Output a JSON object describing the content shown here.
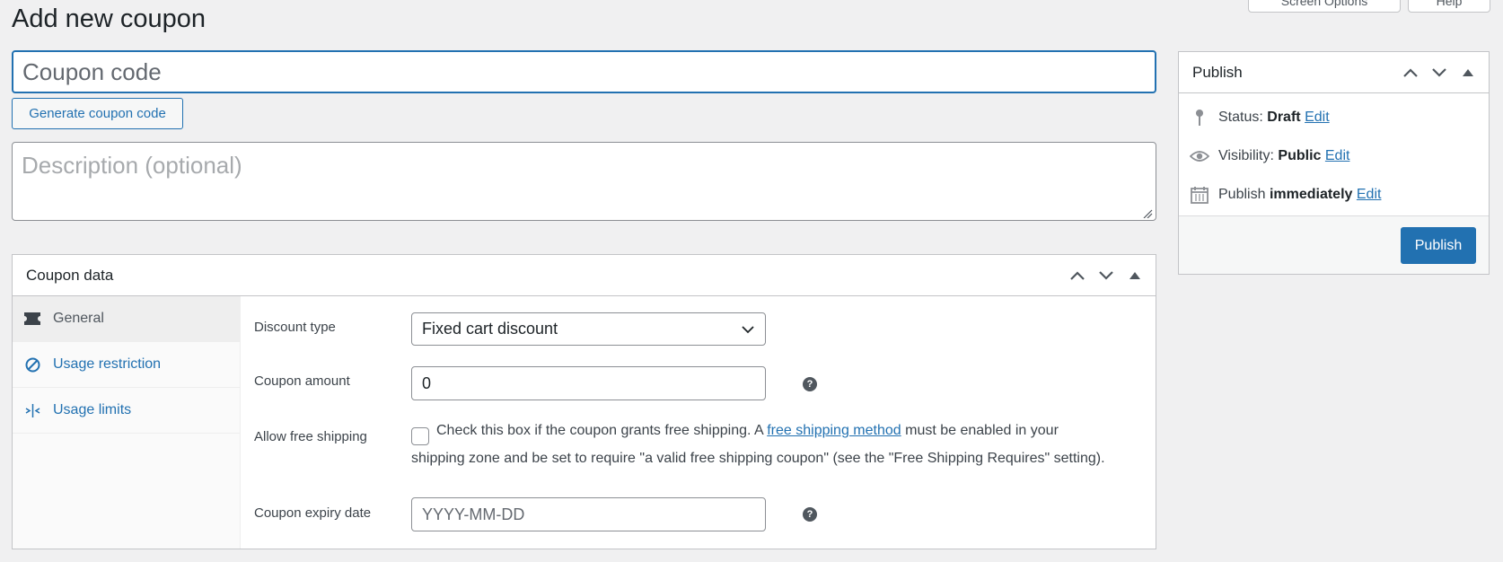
{
  "header": {
    "screen_options_label": "Screen Options",
    "help_label": "Help",
    "title": "Add new coupon"
  },
  "coupon_code": {
    "placeholder": "Coupon code",
    "value": ""
  },
  "generate_label": "Generate coupon code",
  "description": {
    "placeholder": "Description (optional)"
  },
  "coupon_data": {
    "title": "Coupon data",
    "tabs": [
      {
        "label": "General",
        "icon": "ticket-icon",
        "active": true
      },
      {
        "label": "Usage restriction",
        "icon": "restriction-icon"
      },
      {
        "label": "Usage limits",
        "icon": "limits-icon"
      }
    ],
    "fields": {
      "discount_type": {
        "label": "Discount type",
        "value": "Fixed cart discount"
      },
      "coupon_amount": {
        "label": "Coupon amount",
        "value": "0"
      },
      "free_shipping": {
        "label": "Allow free shipping",
        "checked": false,
        "text_before": "Check this box if the coupon grants free shipping. A ",
        "link": "free shipping method",
        "text_after": " must be enabled in your",
        "line2": "shipping zone and be set to require \"a valid free shipping coupon\" (see the \"Free Shipping Requires\" setting)."
      },
      "expiry_date": {
        "label": "Coupon expiry date",
        "placeholder": "YYYY-MM-DD"
      }
    }
  },
  "publish": {
    "title": "Publish",
    "status_label": "Status:",
    "status_value": "Draft",
    "visibility_label": "Visibility:",
    "visibility_value": "Public",
    "schedule_label": "Publish",
    "schedule_value": "immediately",
    "edit_label": "Edit",
    "button_label": "Publish"
  },
  "colors": {
    "accent": "#2271b1",
    "background": "#f0f0f1"
  }
}
